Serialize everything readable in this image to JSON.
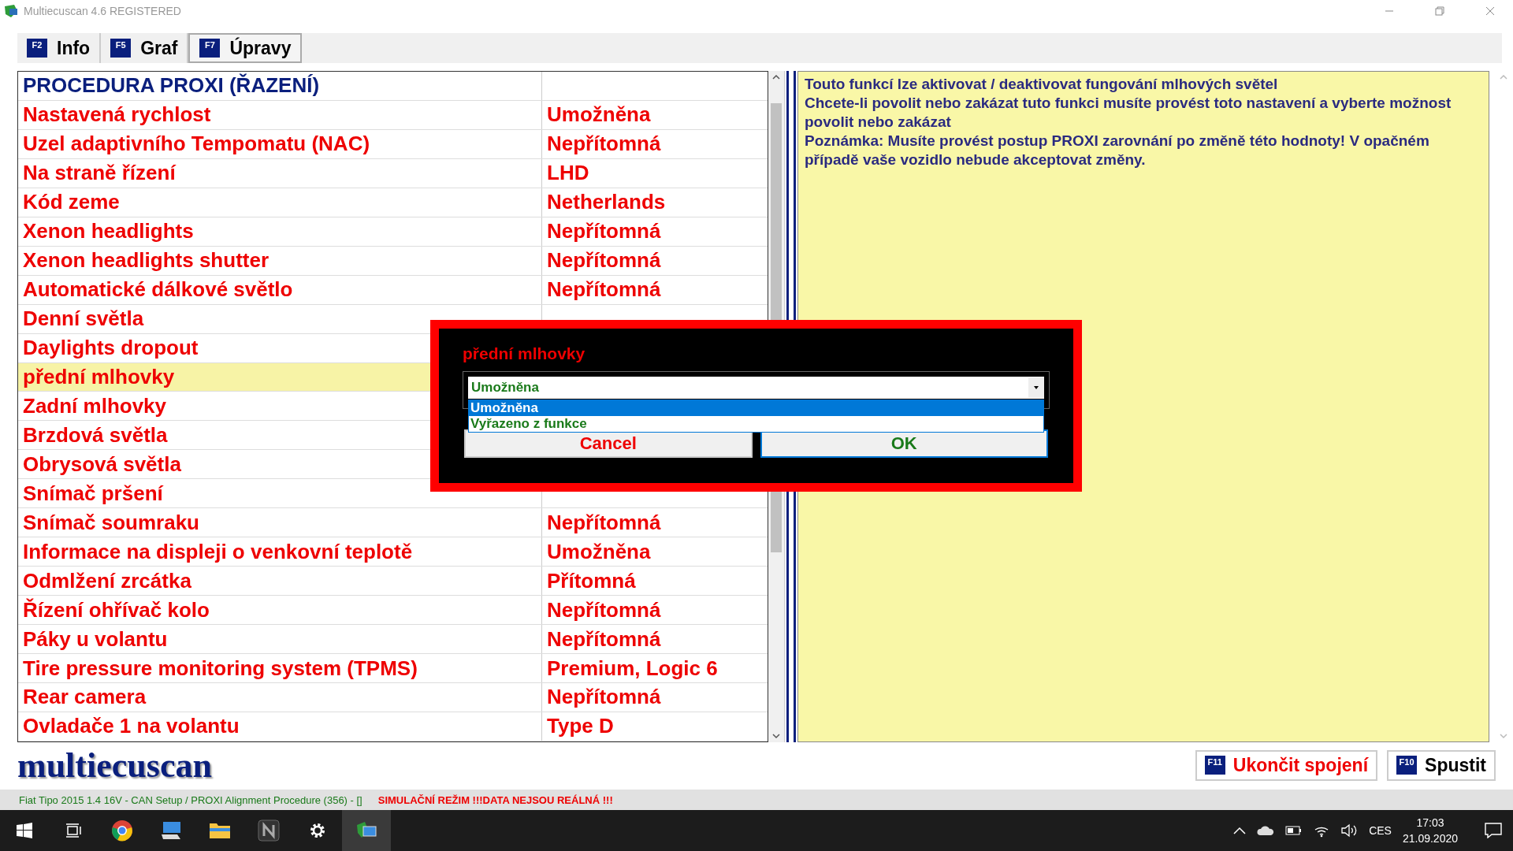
{
  "window": {
    "title": "Multiecuscan 4.6 REGISTERED"
  },
  "tabs": [
    {
      "key": "F2",
      "label": "Info",
      "selected": false
    },
    {
      "key": "F5",
      "label": "Graf",
      "selected": false
    },
    {
      "key": "F7",
      "label": "Úpravy",
      "selected": true
    }
  ],
  "table": {
    "header": "PROCEDURA PROXI (ŘAZENÍ)",
    "rows": [
      {
        "label": "Nastavená rychlost",
        "value": "Umožněna",
        "selected": false
      },
      {
        "label": "Uzel adaptivního Tempomatu (NAC)",
        "value": "Nepřítomná",
        "selected": false
      },
      {
        "label": "Na straně řízení",
        "value": "LHD",
        "selected": false
      },
      {
        "label": "Kód zeme",
        "value": "Netherlands",
        "selected": false
      },
      {
        "label": "Xenon headlights",
        "value": "Nepřítomná",
        "selected": false
      },
      {
        "label": "Xenon headlights shutter",
        "value": "Nepřítomná",
        "selected": false
      },
      {
        "label": "Automatické dálkové světlo",
        "value": "Nepřítomná",
        "selected": false
      },
      {
        "label": "Denní světla",
        "selected": false
      },
      {
        "label": "Daylights dropout",
        "selected": false
      },
      {
        "label": "přední mlhovky",
        "selected": true
      },
      {
        "label": "Zadní mlhovky",
        "selected": false
      },
      {
        "label": "Brzdová světla",
        "selected": false
      },
      {
        "label": "Obrysová světla",
        "selected": false
      },
      {
        "label": "Snímač pršení",
        "selected": false
      },
      {
        "label": "Snímač soumraku",
        "value": "Nepřítomná",
        "selected": false
      },
      {
        "label": "Informace na displeji o venkovní teplotě",
        "value": "Umožněna",
        "selected": false
      },
      {
        "label": "Odmlžení zrcátka",
        "value": "Přítomná",
        "selected": false
      },
      {
        "label": "Řízení ohřívač kolo",
        "value": "Nepřítomná",
        "selected": false
      },
      {
        "label": "Páky u volantu",
        "value": "Nepřítomná",
        "selected": false
      },
      {
        "label": "Tire pressure monitoring system (TPMS)",
        "value": "Premium, Logic 6",
        "selected": false
      },
      {
        "label": "Rear camera",
        "value": "Nepřítomná",
        "selected": false
      },
      {
        "label": "Ovladače 1 na volantu",
        "value": "Type D",
        "selected": false
      }
    ]
  },
  "description": [
    "Touto funkcí lze aktivovat / deaktivovat fungování mlhových světel",
    "Chcete-li povolit nebo zakázat tuto funkci musíte provést toto nastavení a vyberte možnost povolit nebo zakázat",
    "Poznámka: Musíte provést postup PROXI zarovnání po změně této hodnoty! V opačném případě vaše vozidlo nebude akceptovat změny."
  ],
  "dialog": {
    "title": "přední mlhovky",
    "value": "Umožněna",
    "options": [
      {
        "label": "Umožněna",
        "selected": true
      },
      {
        "label": "Vyřazeno z funkce",
        "selected": false
      }
    ],
    "cancel": "Cancel",
    "ok": "OK"
  },
  "logo": "multiecuscan",
  "actions": [
    {
      "key": "F11",
      "label": "Ukončit spojení",
      "kind": "danger"
    },
    {
      "key": "F10",
      "label": "Spustit",
      "kind": "normal"
    }
  ],
  "status_bar": {
    "vehicle": "Fiat Tipo 2015 1.4 16V - CAN Setup / PROXI Alignment Procedure (356) - []",
    "warning": "SIMULAČNÍ REŽIM !!!DATA NEJSOU REÁLNÁ !!!"
  },
  "taskbar": {
    "language": "CES",
    "time": "17:03",
    "date": "21.09.2020"
  }
}
